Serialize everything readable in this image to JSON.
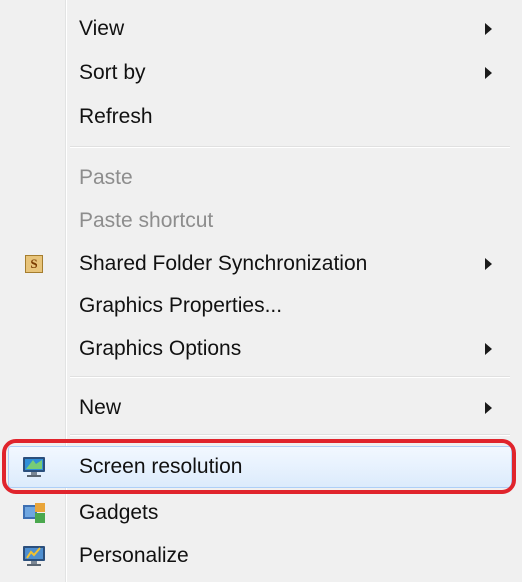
{
  "menu": {
    "items": [
      {
        "label": "View",
        "submenu": true,
        "enabled": true
      },
      {
        "label": "Sort by",
        "submenu": true,
        "enabled": true
      },
      {
        "label": "Refresh",
        "submenu": false,
        "enabled": true
      },
      {
        "label": "Paste",
        "submenu": false,
        "enabled": false
      },
      {
        "label": "Paste shortcut",
        "submenu": false,
        "enabled": false
      },
      {
        "label": "Shared Folder Synchronization",
        "submenu": true,
        "enabled": true,
        "icon": "shared-folder-sync-icon",
        "icon_text": "S"
      },
      {
        "label": "Graphics Properties...",
        "submenu": false,
        "enabled": true
      },
      {
        "label": "Graphics Options",
        "submenu": true,
        "enabled": true
      },
      {
        "label": "New",
        "submenu": true,
        "enabled": true
      },
      {
        "label": "Screen resolution",
        "submenu": false,
        "enabled": true,
        "icon": "screen-resolution-icon",
        "highlighted": true
      },
      {
        "label": "Gadgets",
        "submenu": false,
        "enabled": true,
        "icon": "gadgets-icon"
      },
      {
        "label": "Personalize",
        "submenu": false,
        "enabled": true,
        "icon": "personalize-icon"
      }
    ]
  },
  "annotation": {
    "highlight_color": "#e0242c"
  }
}
